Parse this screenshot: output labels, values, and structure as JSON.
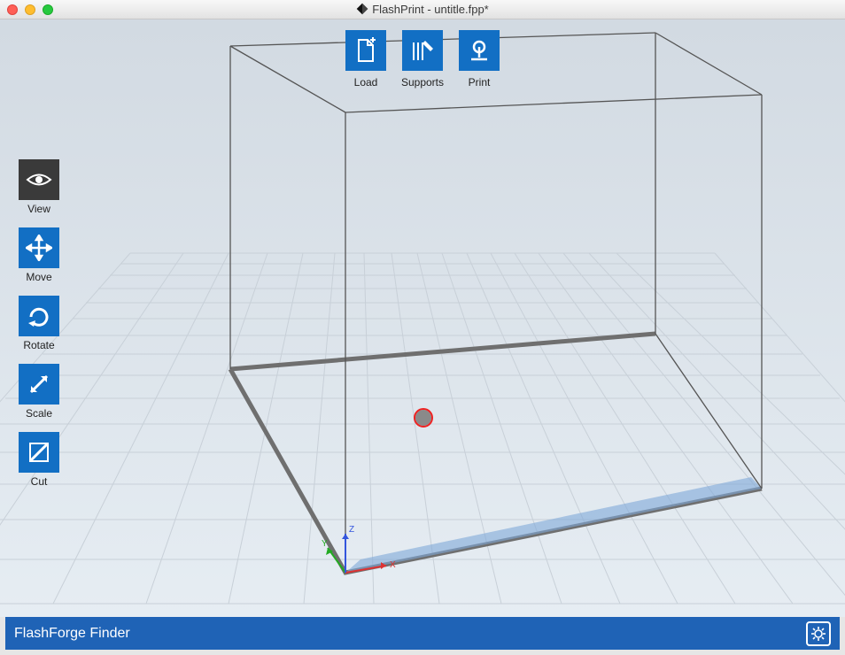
{
  "app": {
    "title": "FlashPrint - untitle.fpp*"
  },
  "toolbar_top": {
    "load": {
      "label": "Load"
    },
    "supports": {
      "label": "Supports"
    },
    "print": {
      "label": "Print"
    }
  },
  "toolbar_left": {
    "view": {
      "label": "View"
    },
    "move": {
      "label": "Move"
    },
    "rotate": {
      "label": "Rotate"
    },
    "scale": {
      "label": "Scale"
    },
    "cut": {
      "label": "Cut"
    }
  },
  "axes": {
    "x": "X",
    "y": "Y",
    "z": "Z"
  },
  "statusbar": {
    "printer_name": "FlashForge Finder"
  },
  "colors": {
    "primary": "#126fc4",
    "statusbar": "#1f63b6"
  }
}
